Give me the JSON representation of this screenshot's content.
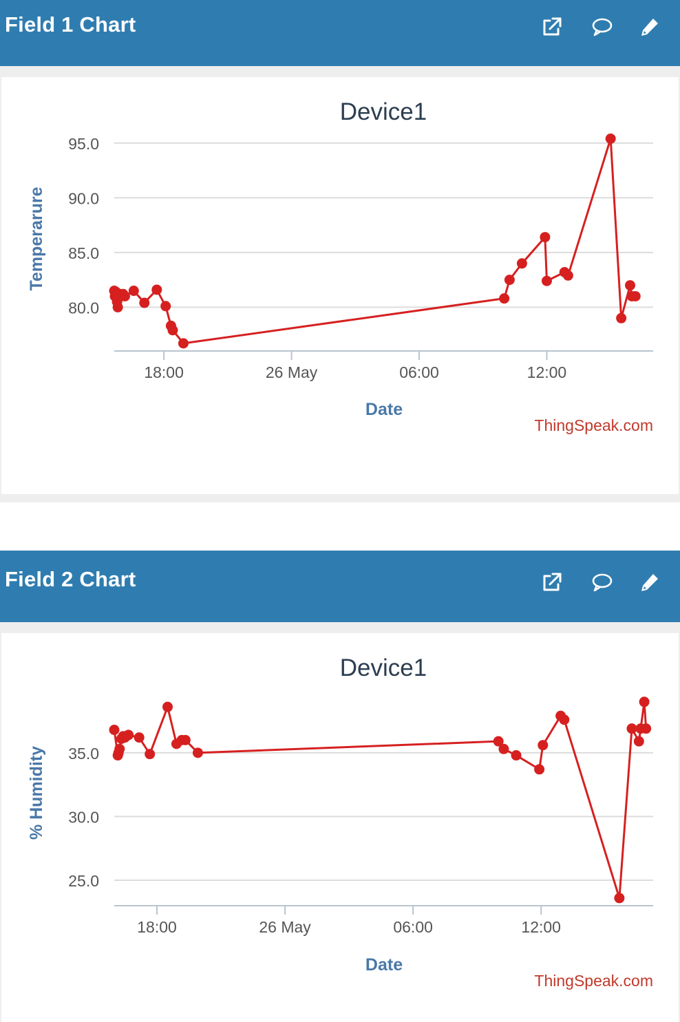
{
  "panels": [
    {
      "title": "Field 1 Chart",
      "icons": [
        "external-link-icon",
        "comment-icon",
        "pencil-icon"
      ]
    },
    {
      "title": "Field 2 Chart",
      "icons": [
        "external-link-icon",
        "comment-icon",
        "pencil-icon"
      ]
    }
  ],
  "colors": {
    "header": "#2f7db0",
    "series": "#d62020",
    "title": "#2c3e50",
    "axis_label": "#4a78a8",
    "credit": "#c0392b"
  },
  "chart_data": [
    {
      "type": "line",
      "title": "Device1",
      "xlabel": "Date",
      "ylabel": "Temperarure",
      "credit": "ThingSpeak.com",
      "grid": true,
      "legend": "none",
      "x_range": [
        "2017-05-25 15:40",
        "2017-05-26 17:00"
      ],
      "ylim": [
        76.0,
        96.5
      ],
      "y_ticks": [
        80.0,
        85.0,
        90.0,
        95.0
      ],
      "y_tick_labels": [
        "80.0",
        "85.0",
        "90.0",
        "95.0"
      ],
      "x_ticks": [
        "2017-05-25 18:00",
        "2017-05-26 00:00",
        "2017-05-26 06:00",
        "2017-05-26 12:00"
      ],
      "x_tick_labels": [
        "18:00",
        "26 May",
        "06:00",
        "12:00"
      ],
      "series": [
        {
          "x": [
            "2017-05-25 15:40",
            "2017-05-25 15:42",
            "2017-05-25 15:45",
            "2017-05-25 15:48",
            "2017-05-25 15:50",
            "2017-05-25 15:55",
            "2017-05-25 16:00",
            "2017-05-25 16:05",
            "2017-05-25 16:10",
            "2017-05-25 16:35",
            "2017-05-25 17:05",
            "2017-05-25 17:40",
            "2017-05-25 18:05",
            "2017-05-25 18:20",
            "2017-05-25 18:25",
            "2017-05-25 18:55",
            "2017-05-26 10:00",
            "2017-05-26 10:15",
            "2017-05-26 10:50",
            "2017-05-26 11:55",
            "2017-05-26 12:00",
            "2017-05-26 12:50",
            "2017-05-26 13:00",
            "2017-05-26 15:00",
            "2017-05-26 15:30",
            "2017-05-26 15:55",
            "2017-05-26 16:00",
            "2017-05-26 16:10"
          ],
          "y": [
            81.5,
            81.0,
            81.4,
            80.5,
            80.0,
            81.2,
            81.0,
            81.2,
            81.0,
            81.5,
            80.4,
            81.6,
            80.1,
            78.3,
            77.9,
            76.7,
            80.8,
            82.5,
            84.0,
            86.4,
            82.4,
            83.2,
            82.9,
            95.4,
            79.0,
            82.0,
            81.0,
            81.0
          ]
        }
      ]
    },
    {
      "type": "line",
      "title": "Device1",
      "xlabel": "Date",
      "ylabel": "% Humidity",
      "credit": "ThingSpeak.com",
      "grid": true,
      "legend": "none",
      "x_range": [
        "2017-05-25 16:00",
        "2017-05-26 17:15"
      ],
      "ylim": [
        23.0,
        40.5
      ],
      "y_ticks": [
        25.0,
        30.0,
        35.0
      ],
      "y_tick_labels": [
        "25.0",
        "30.0",
        "35.0"
      ],
      "x_ticks": [
        "2017-05-25 18:00",
        "2017-05-26 00:00",
        "2017-05-26 06:00",
        "2017-05-26 12:00"
      ],
      "x_tick_labels": [
        "18:00",
        "26 May",
        "06:00",
        "12:00"
      ],
      "series": [
        {
          "x": [
            "2017-05-25 16:00",
            "2017-05-25 16:10",
            "2017-05-25 16:12",
            "2017-05-25 16:15",
            "2017-05-25 16:20",
            "2017-05-25 16:25",
            "2017-05-25 16:30",
            "2017-05-25 16:40",
            "2017-05-25 17:10",
            "2017-05-25 17:40",
            "2017-05-25 18:30",
            "2017-05-25 18:55",
            "2017-05-25 19:10",
            "2017-05-25 19:20",
            "2017-05-25 19:55",
            "2017-05-26 10:00",
            "2017-05-26 10:15",
            "2017-05-26 10:50",
            "2017-05-26 11:55",
            "2017-05-26 12:05",
            "2017-05-26 12:55",
            "2017-05-26 13:05",
            "2017-05-26 15:40",
            "2017-05-26 16:15",
            "2017-05-26 16:35",
            "2017-05-26 16:40",
            "2017-05-26 16:50",
            "2017-05-26 16:55"
          ],
          "y": [
            36.8,
            34.8,
            35.0,
            35.3,
            36.1,
            36.3,
            36.2,
            36.4,
            36.2,
            34.9,
            38.6,
            35.7,
            36.0,
            36.0,
            35.0,
            35.9,
            35.3,
            34.8,
            33.7,
            35.6,
            37.9,
            37.6,
            23.6,
            36.9,
            35.9,
            36.9,
            39.0,
            36.9
          ]
        }
      ]
    }
  ]
}
